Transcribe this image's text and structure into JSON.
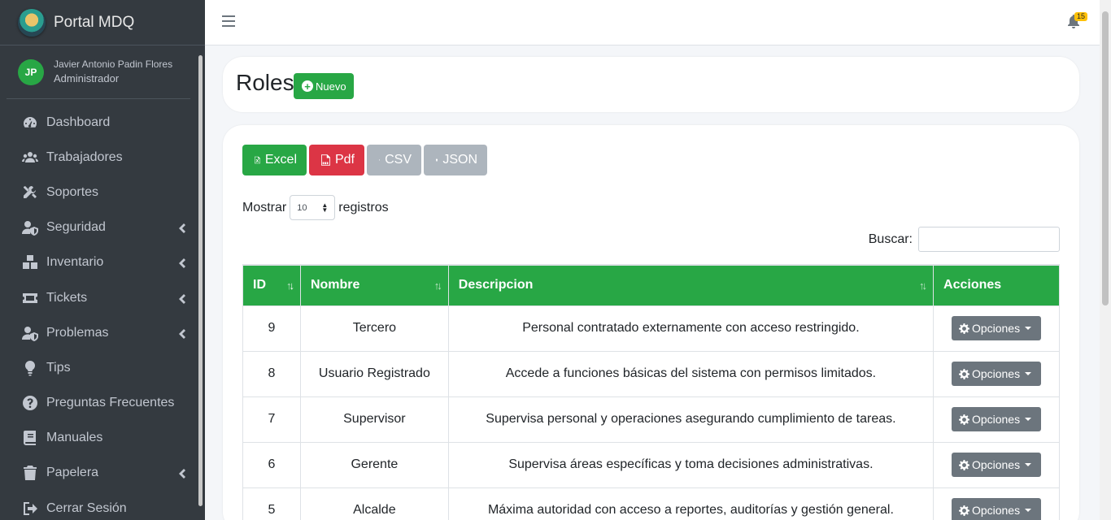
{
  "brand": {
    "name": "Portal MDQ"
  },
  "user": {
    "initials": "JP",
    "name": "Javier Antonio Padin Flores",
    "role": "Administrador"
  },
  "sidebar": {
    "items": [
      {
        "label": "Dashboard",
        "icon": "tachometer-icon",
        "has_submenu": false
      },
      {
        "label": "Trabajadores",
        "icon": "users-icon",
        "has_submenu": false
      },
      {
        "label": "Soportes",
        "icon": "tools-icon",
        "has_submenu": false
      },
      {
        "label": "Seguridad",
        "icon": "user-shield-icon",
        "has_submenu": true
      },
      {
        "label": "Inventario",
        "icon": "boxes-icon",
        "has_submenu": true
      },
      {
        "label": "Tickets",
        "icon": "ticket-icon",
        "has_submenu": true
      },
      {
        "label": "Problemas",
        "icon": "user-shield-icon",
        "has_submenu": true
      },
      {
        "label": "Tips",
        "icon": "lightbulb-icon",
        "has_submenu": false
      },
      {
        "label": "Preguntas Frecuentes",
        "icon": "question-circle-icon",
        "has_submenu": false
      },
      {
        "label": "Manuales",
        "icon": "book-icon",
        "has_submenu": false
      },
      {
        "label": "Papelera",
        "icon": "trash-icon",
        "has_submenu": true
      },
      {
        "label": "Cerrar Sesión",
        "icon": "sign-out-icon",
        "has_submenu": false
      }
    ]
  },
  "topbar": {
    "notification_count": "15"
  },
  "page": {
    "title": "Roles",
    "new_button": "Nuevo"
  },
  "export": {
    "excel": "Excel",
    "pdf": "Pdf",
    "csv": "CSV",
    "json": "JSON"
  },
  "table_controls": {
    "show_prefix": "Mostrar",
    "page_length": "10",
    "show_suffix": "registros",
    "search_label": "Buscar:"
  },
  "table": {
    "columns": [
      "ID",
      "Nombre",
      "Descripcion",
      "Acciones"
    ],
    "rows": [
      {
        "id": "9",
        "nombre": "Tercero",
        "descripcion": "Personal contratado externamente con acceso restringido.",
        "accion": "Opciones"
      },
      {
        "id": "8",
        "nombre": "Usuario Registrado",
        "descripcion": "Accede a funciones básicas del sistema con permisos limitados.",
        "accion": "Opciones"
      },
      {
        "id": "7",
        "nombre": "Supervisor",
        "descripcion": "Supervisa personal y operaciones asegurando cumplimiento de tareas.",
        "accion": "Opciones"
      },
      {
        "id": "6",
        "nombre": "Gerente",
        "descripcion": "Supervisa áreas específicas y toma decisiones administrativas.",
        "accion": "Opciones"
      },
      {
        "id": "5",
        "nombre": "Alcalde",
        "descripcion": "Máxima autoridad con acceso a reportes, auditorías y gestión general.",
        "accion": "Opciones"
      }
    ]
  },
  "colors": {
    "sidebar_bg": "#343a40",
    "accent_green": "#28a745",
    "danger_red": "#dc3545",
    "secondary_gray": "#6c757d"
  }
}
